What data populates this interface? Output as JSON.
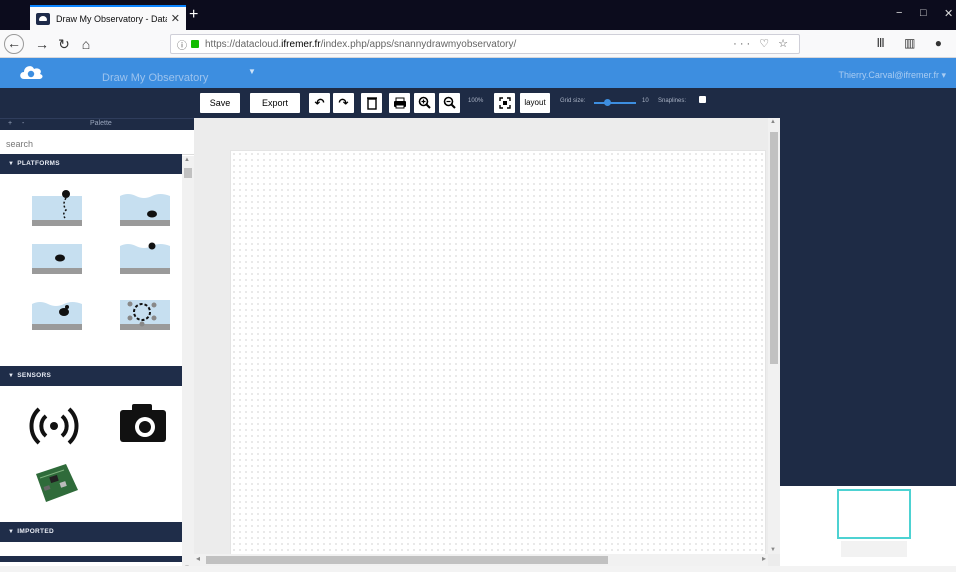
{
  "browser": {
    "tab_title": "Draw My Observatory - Datacl",
    "tab_close": "✕",
    "new_tab": "+",
    "window_controls": [
      "−",
      "□",
      "✕"
    ],
    "url_prefix": "https://datacloud.",
    "url_domain": "ifremer.fr",
    "url_suffix": "/index.php/apps/snannydrawmyobservatory/",
    "url_actions": "··· ♡ ☆",
    "toolbar_right": "Ⅲ ▥ ●"
  },
  "app": {
    "title": "Draw My Observatory",
    "user": "Thierry.Carval@ifremer.fr ▾"
  },
  "palette": {
    "label": "Palette",
    "buttons": "+ -",
    "search_placeholder": "search",
    "sections": {
      "platforms": "PLATFORMS",
      "sensors": "SENSORS",
      "imported": "IMPORTED"
    }
  },
  "toolbar": {
    "save": "Save",
    "export": "Export",
    "zoom_level": "100%",
    "layout": "layout",
    "grid_size_label": "Grid size:",
    "grid_size_value": "10",
    "snaplines_label": "Snaplines:",
    "icons": [
      "undo-icon",
      "redo-icon",
      "trash-icon",
      "print-icon",
      "zoom-in-icon",
      "zoom-out-icon",
      "fit-icon"
    ]
  },
  "colors": {
    "header_blue": "#3d8ee0",
    "dark_navy": "#1e2b45",
    "outline_cyan": "#4dd2d2"
  }
}
